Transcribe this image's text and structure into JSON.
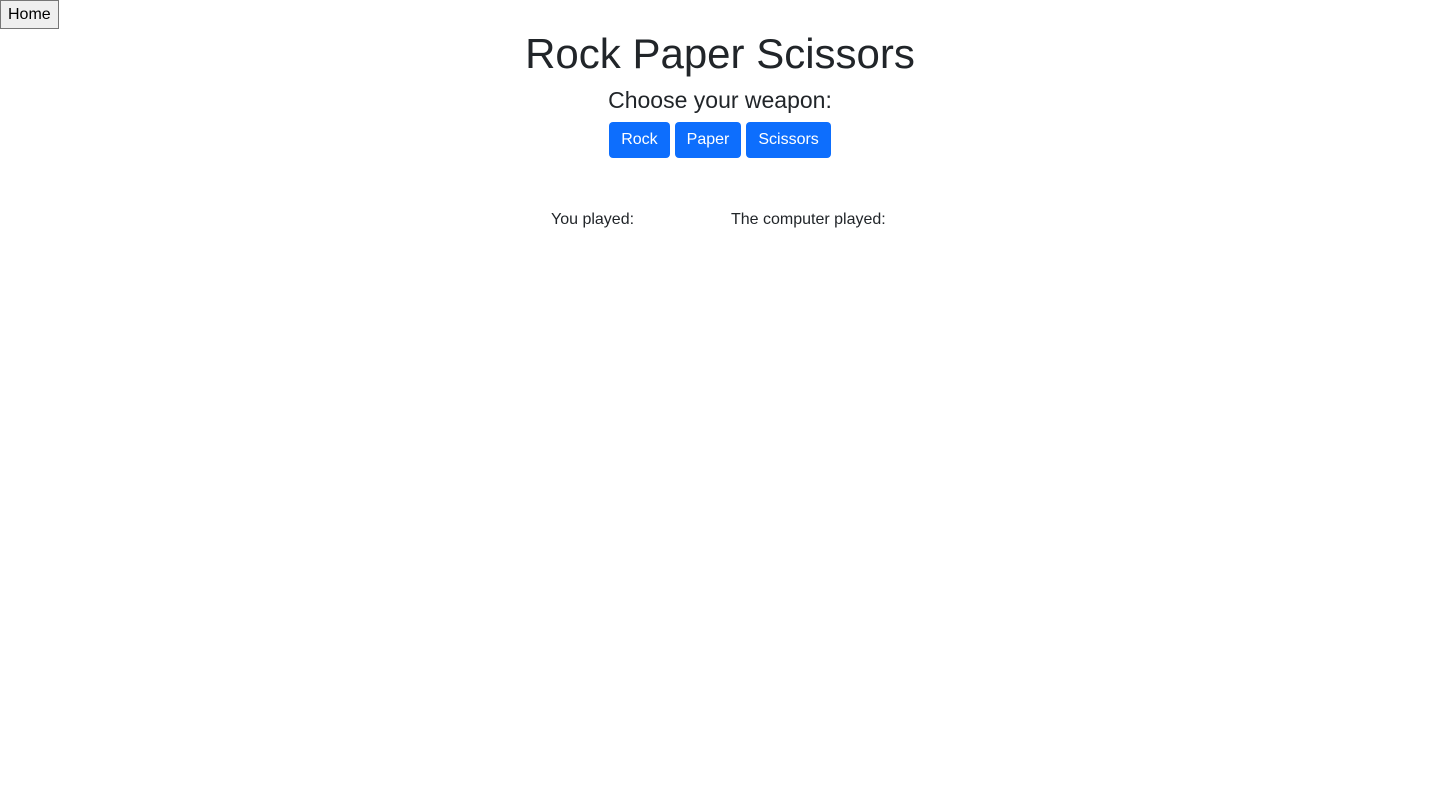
{
  "nav": {
    "home_label": "Home"
  },
  "header": {
    "title": "Rock Paper Scissors",
    "prompt": "Choose your weapon:"
  },
  "weapons": [
    {
      "label": "Rock"
    },
    {
      "label": "Paper"
    },
    {
      "label": "Scissors"
    }
  ],
  "results": {
    "you_label": "You played:",
    "computer_label": "The computer played:"
  },
  "colors": {
    "primary": "#0d6efd",
    "text": "#212529",
    "background": "#ffffff"
  }
}
